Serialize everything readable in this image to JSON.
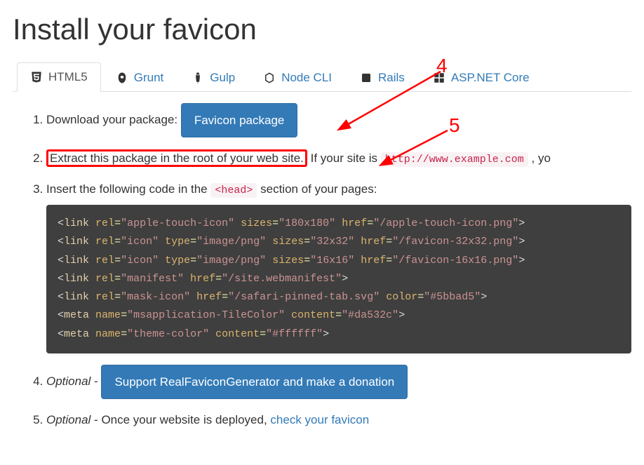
{
  "heading": "Install your favicon",
  "tabs": [
    {
      "label": "HTML5",
      "icon": "html5",
      "active": true
    },
    {
      "label": "Grunt",
      "icon": "grunt",
      "active": false
    },
    {
      "label": "Gulp",
      "icon": "gulp",
      "active": false
    },
    {
      "label": "Node CLI",
      "icon": "nodejs",
      "active": false
    },
    {
      "label": "Rails",
      "icon": "rails",
      "active": false
    },
    {
      "label": "ASP.NET Core",
      "icon": "aspnet",
      "active": false
    }
  ],
  "steps": {
    "s1_prefix": "Download your package: ",
    "s1_button": "Favicon package",
    "s2_boxed": "Extract this package in the root of your web site.",
    "s2_after": " If your site is ",
    "s2_code": "http://www.example.com",
    "s2_tail": " , yo",
    "s3_prefix": "Insert the following code in the ",
    "s3_code": "<head>",
    "s3_suffix": " section of your pages:",
    "s4_prefix": "Optional",
    "s4_dash": " - ",
    "s4_button": "Support RealFaviconGenerator and make a donation",
    "s5_prefix": "Optional",
    "s5_dash": " - ",
    "s5_text": "Once your website is deployed, ",
    "s5_link": "check your favicon"
  },
  "code_lines": [
    {
      "tag": "link",
      "attrs": [
        [
          "rel",
          "apple-touch-icon"
        ],
        [
          "sizes",
          "180x180"
        ],
        [
          "href",
          "/apple-touch-icon.png"
        ]
      ]
    },
    {
      "tag": "link",
      "attrs": [
        [
          "rel",
          "icon"
        ],
        [
          "type",
          "image/png"
        ],
        [
          "sizes",
          "32x32"
        ],
        [
          "href",
          "/favicon-32x32.png"
        ]
      ]
    },
    {
      "tag": "link",
      "attrs": [
        [
          "rel",
          "icon"
        ],
        [
          "type",
          "image/png"
        ],
        [
          "sizes",
          "16x16"
        ],
        [
          "href",
          "/favicon-16x16.png"
        ]
      ]
    },
    {
      "tag": "link",
      "attrs": [
        [
          "rel",
          "manifest"
        ],
        [
          "href",
          "/site.webmanifest"
        ]
      ]
    },
    {
      "tag": "link",
      "attrs": [
        [
          "rel",
          "mask-icon"
        ],
        [
          "href",
          "/safari-pinned-tab.svg"
        ],
        [
          "color",
          "#5bbad5"
        ]
      ]
    },
    {
      "tag": "meta",
      "attrs": [
        [
          "name",
          "msapplication-TileColor"
        ],
        [
          "content",
          "#da532c"
        ]
      ]
    },
    {
      "tag": "meta",
      "attrs": [
        [
          "name",
          "theme-color"
        ],
        [
          "content",
          "#ffffff"
        ]
      ]
    }
  ],
  "annotations": {
    "num4": "4",
    "num5": "5"
  }
}
